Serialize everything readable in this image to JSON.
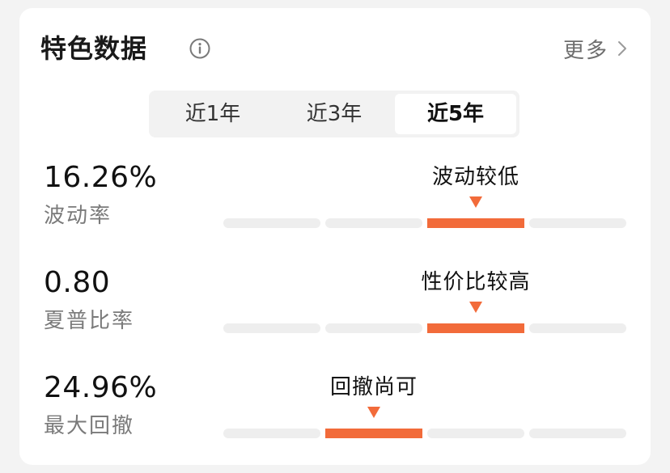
{
  "header": {
    "title": "特色数据",
    "more_label": "更多"
  },
  "tabs": [
    {
      "label": "近1年",
      "active": false
    },
    {
      "label": "近3年",
      "active": false
    },
    {
      "label": "近5年",
      "active": true
    }
  ],
  "metrics": [
    {
      "value": "16.26%",
      "name": "波动率",
      "rating": "波动较低",
      "segment_count": 4,
      "active_segment": 3
    },
    {
      "value": "0.80",
      "name": "夏普比率",
      "rating": "性价比较高",
      "segment_count": 4,
      "active_segment": 3
    },
    {
      "value": "24.96%",
      "name": "最大回撤",
      "rating": "回撤尚可",
      "segment_count": 4,
      "active_segment": 2
    }
  ],
  "colors": {
    "accent": "#f26b3a",
    "track": "#eeeeee",
    "tab_bg": "#f2f2f2"
  },
  "icons": {
    "info": "info-circle-icon",
    "more": "chevron-right-icon",
    "pointer": "triangle-down-icon"
  }
}
